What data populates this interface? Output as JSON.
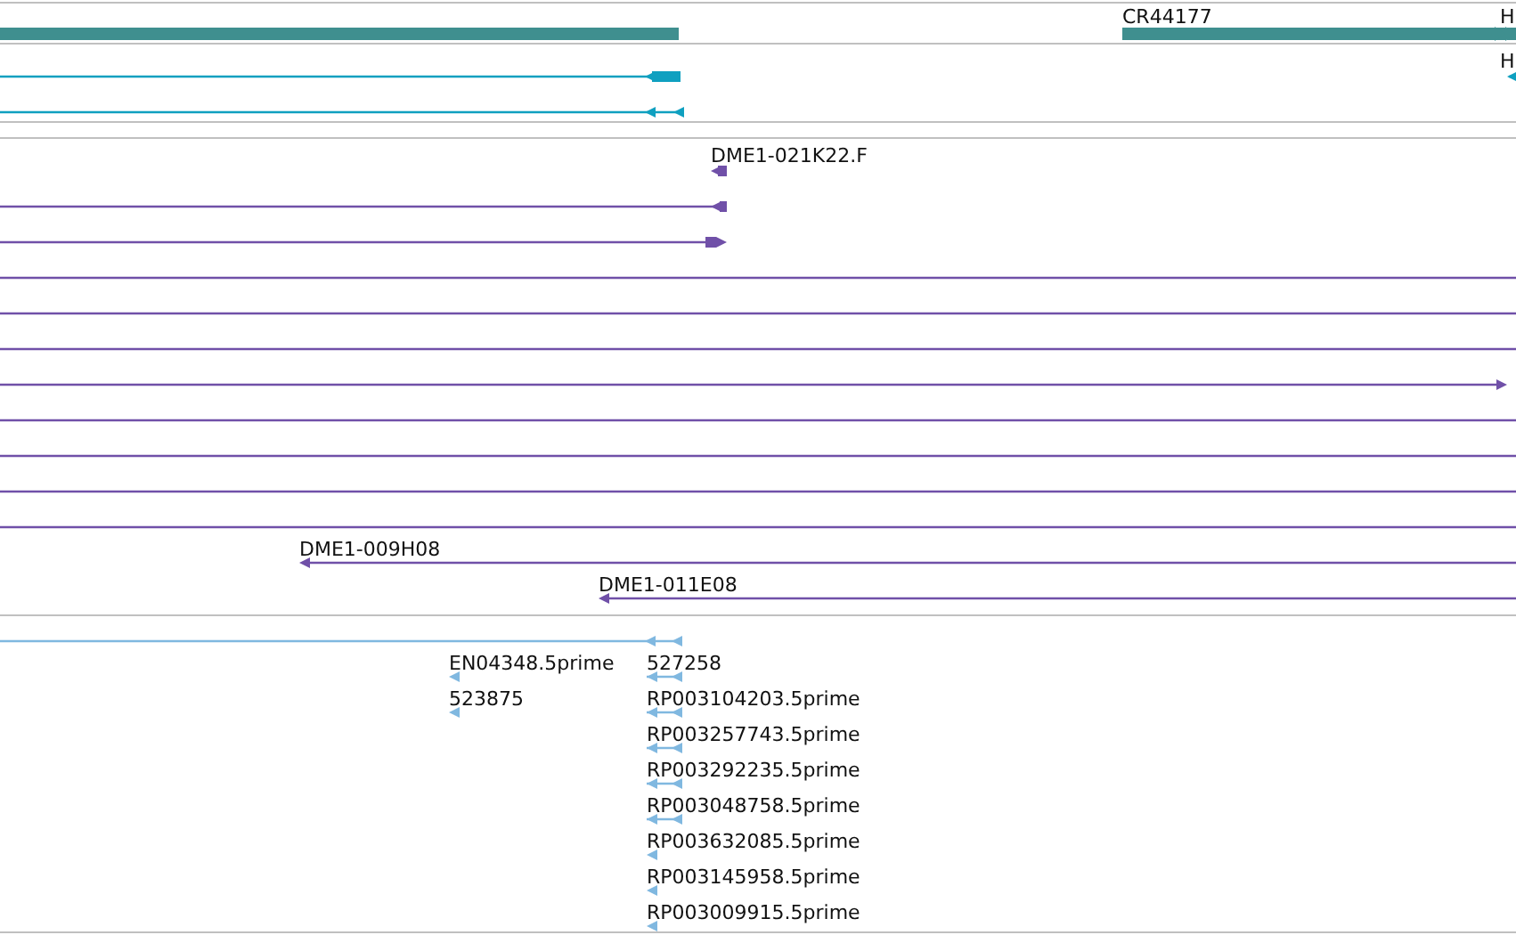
{
  "tracks": [
    {
      "color": "#3f8f8f",
      "features": [
        {
          "kind": "plain"
        },
        {
          "label": "CR44177",
          "kind": "forward"
        },
        {
          "label": "H",
          "kind": "forward"
        }
      ]
    },
    {
      "color": "#0fa0c0",
      "features": [
        {
          "kind": "reverse"
        },
        {
          "label": "H",
          "kind": "reverse"
        },
        {
          "kind": "reverse"
        }
      ]
    },
    {
      "color": "#7050a8",
      "features": [
        {
          "label": "DME1-021K22.F",
          "kind": "reverse"
        },
        {
          "kind": "reverse"
        },
        {
          "kind": "forward"
        },
        {
          "kind": "plain"
        },
        {
          "kind": "plain"
        },
        {
          "kind": "plain"
        },
        {
          "kind": "forward"
        },
        {
          "kind": "plain"
        },
        {
          "kind": "plain"
        },
        {
          "kind": "plain"
        },
        {
          "kind": "plain"
        },
        {
          "label": "DME1-009H08",
          "kind": "reverse"
        },
        {
          "label": "DME1-011E08",
          "kind": "reverse"
        }
      ]
    },
    {
      "color": "#80b8e0",
      "features": [
        {
          "kind": "reverse"
        },
        {
          "label": "EN04348.5prime",
          "kind": "reverse"
        },
        {
          "label": "527258",
          "kind": "reverse"
        },
        {
          "label": "523875",
          "kind": "reverse"
        },
        {
          "label": "RP003104203.5prime",
          "kind": "reverse"
        },
        {
          "label": "RP003257743.5prime",
          "kind": "reverse"
        },
        {
          "label": "RP003292235.5prime",
          "kind": "reverse"
        },
        {
          "label": "RP003048758.5prime",
          "kind": "reverse"
        },
        {
          "label": "RP003632085.5prime",
          "kind": "reverse"
        },
        {
          "label": "RP003145958.5prime",
          "kind": "reverse"
        },
        {
          "label": "RP003009915.5prime",
          "kind": "reverse"
        }
      ]
    }
  ]
}
